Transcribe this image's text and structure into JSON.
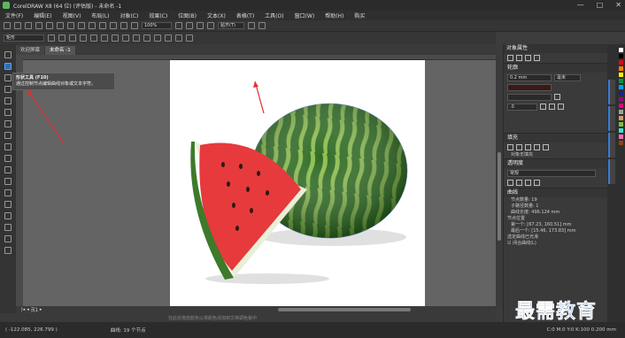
{
  "window": {
    "title": "CorelDRAW X8 (64 位) (评估版) - 未命名 -1",
    "controls": [
      "—",
      "□",
      "✕"
    ]
  },
  "menu": [
    "文件(F)",
    "编辑(E)",
    "视图(V)",
    "布局(L)",
    "对象(C)",
    "效果(C)",
    "位图(B)",
    "文本(X)",
    "表格(T)",
    "工具(O)",
    "窗口(W)",
    "帮助(H)",
    "购买"
  ],
  "toolbar": {
    "zoom": "100%",
    "snap_label": "贴齐(T)"
  },
  "propbar": {
    "shape_select": "矩形"
  },
  "tabs": [
    {
      "label": "欢迎屏幕"
    },
    {
      "label": "未命名 -1"
    }
  ],
  "tooltip": {
    "title": "形状工具 (F10)",
    "desc": "通过控制节点编辑曲线对象或文本字符。"
  },
  "pagenav": {
    "page": "页1"
  },
  "dock": {
    "title": "对象属性",
    "outline_section": "轮廓",
    "outline_width": "0.2 mm",
    "outline_unit": "毫米",
    "outline_value": ".0",
    "fill_section": "填充",
    "fill_desc": "对象无填充",
    "transparency_section": "透明度",
    "transparency_mode": "常规",
    "curve_section": "曲线",
    "node_count_label": "节点数量: 19",
    "subpath_label": "子路径数量: 1",
    "curve_length_label": "曲线长度: 496.124 mm",
    "node_position_label": "节点位置",
    "first_label": "第一个:",
    "first_value": "[67.23, 160.51] mm",
    "last_label": "最后一个:",
    "last_value": "[15.46, 173.83] mm",
    "smooth_label": "选定曲线已光滑",
    "closed_label": "闭合曲线(L)"
  },
  "status": {
    "coords": "( -122.085, 226.799 )",
    "object_info": "曲线: 19 个节点",
    "hint": "在此处拖放颜色以将颜色添加到文档调色板中",
    "color_info": "C:0 M:0 Y:0 K:100  0.200 mm"
  },
  "watermark": "最需教育",
  "colors": {
    "accent": "#3a7bd5",
    "arrow": "#e03030"
  },
  "palette": [
    "#ffffff",
    "#000000",
    "#e3001b",
    "#ff7f00",
    "#ffed00",
    "#00963f",
    "#00a0e9",
    "#1d2088",
    "#920783",
    "#e5007f",
    "#a0a0a0",
    "#c8a165",
    "#7fbf3f",
    "#40e0d0",
    "#ff69b4",
    "#8b4513"
  ]
}
